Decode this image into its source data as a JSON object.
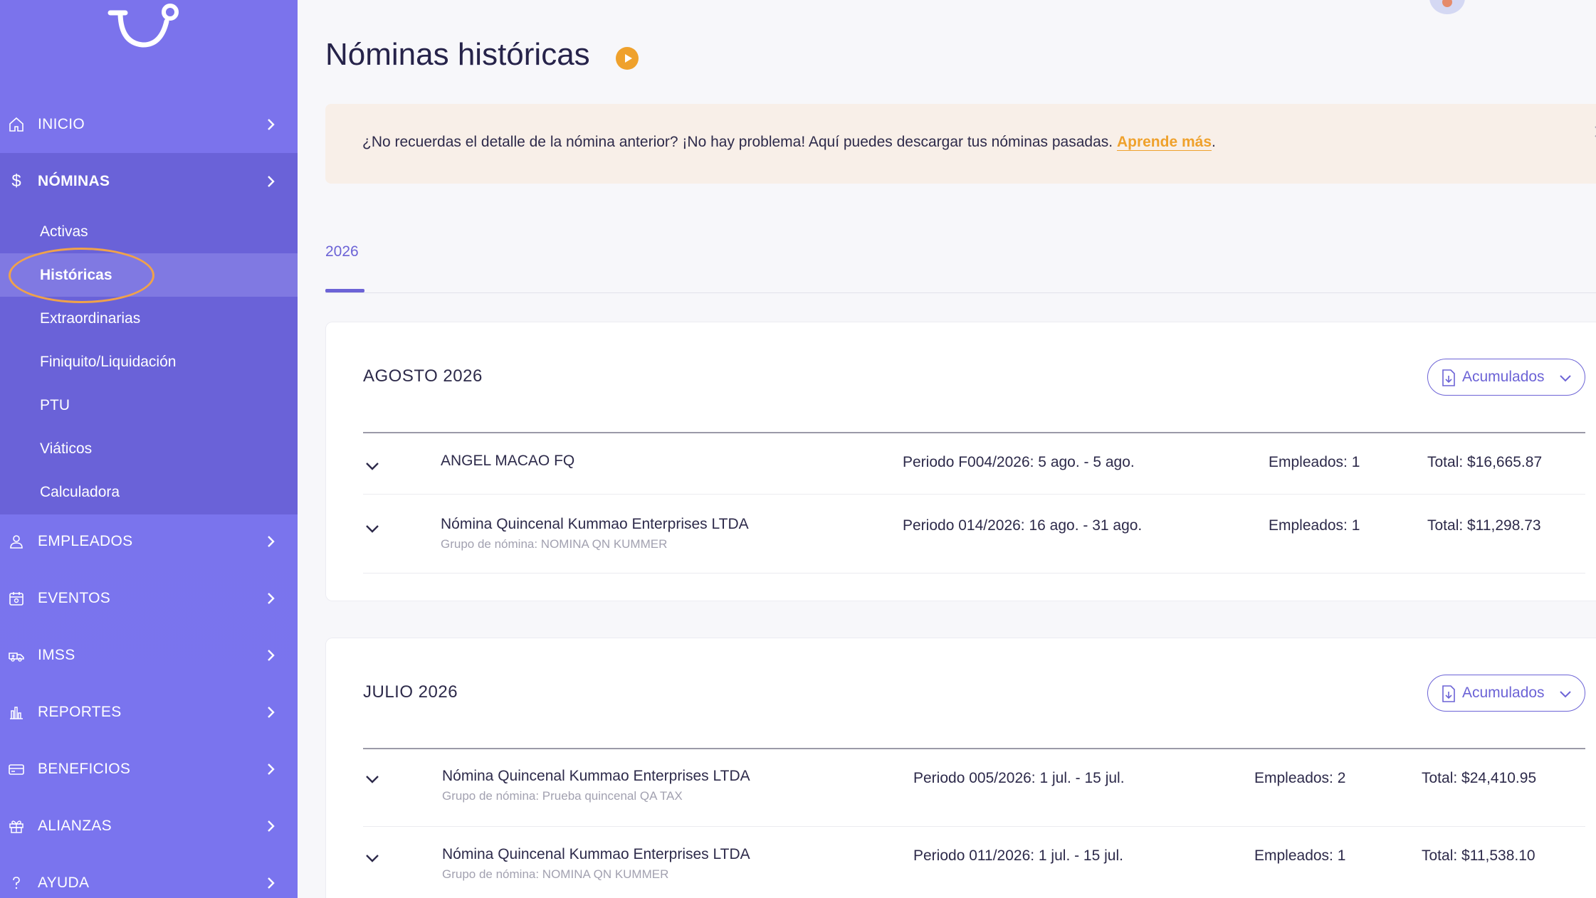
{
  "sidebar": {
    "items": [
      {
        "label": "INICIO",
        "icon": "home-icon"
      },
      {
        "label": "NÓMINAS",
        "icon": "dollar-icon"
      },
      {
        "label": "EMPLEADOS",
        "icon": "user-icon"
      },
      {
        "label": "EVENTOS",
        "icon": "calendar-icon"
      },
      {
        "label": "IMSS",
        "icon": "ambulance-icon"
      },
      {
        "label": "REPORTES",
        "icon": "bar-chart-icon"
      },
      {
        "label": "BENEFICIOS",
        "icon": "card-icon"
      },
      {
        "label": "ALIANZAS",
        "icon": "gift-icon"
      },
      {
        "label": "AYUDA",
        "icon": "help-icon"
      }
    ],
    "subitems": [
      "Activas",
      "Históricas",
      "Extraordinarias",
      "Finiquito/Liquidación",
      "PTU",
      "Viáticos",
      "Calculadora"
    ]
  },
  "header": {
    "title": "Nóminas históricas"
  },
  "banner": {
    "text": "¿No recuerdas el detalle de la nómina anterior? ¡No hay problema! Aquí puedes descargar tus nóminas pasadas. ",
    "link": "Aprende más",
    "suffix": "."
  },
  "tabs": [
    "2026"
  ],
  "months": [
    {
      "title": "AGOSTO 2026",
      "button": "Acumulados",
      "rows": [
        {
          "name": "ANGEL MACAO FQ",
          "group": "",
          "period": "Periodo F004/2026: 5 ago. - 5 ago.",
          "employees": "Empleados: 1",
          "total": "Total: $16,665.87"
        },
        {
          "name": "Nómina Quincenal Kummao Enterprises LTDA",
          "group": "Grupo de nómina: NOMINA QN KUMMER",
          "period": "Periodo 014/2026: 16 ago. - 31 ago.",
          "employees": "Empleados: 1",
          "total": "Total: $11,298.73"
        }
      ]
    },
    {
      "title": "JULIO 2026",
      "button": "Acumulados",
      "rows": [
        {
          "name": "Nómina Quincenal Kummao Enterprises LTDA",
          "group": "Grupo de nómina: Prueba quincenal QA TAX",
          "period": "Periodo 005/2026: 1 jul. - 15 jul.",
          "employees": "Empleados: 2",
          "total": "Total: $24,410.95"
        },
        {
          "name": "Nómina Quincenal Kummao Enterprises LTDA",
          "group": "Grupo de nómina: NOMINA QN KUMMER",
          "period": "Periodo 011/2026: 1 jul. - 15 jul.",
          "employees": "Empleados: 1",
          "total": "Total: $11,538.10"
        }
      ]
    }
  ],
  "colors": {
    "sidebar": "#7b73ec",
    "sidebar_active": "#6a62d8",
    "accent": "#6c63d6",
    "orange": "#efa12c",
    "banner_bg": "#f8efe8"
  }
}
